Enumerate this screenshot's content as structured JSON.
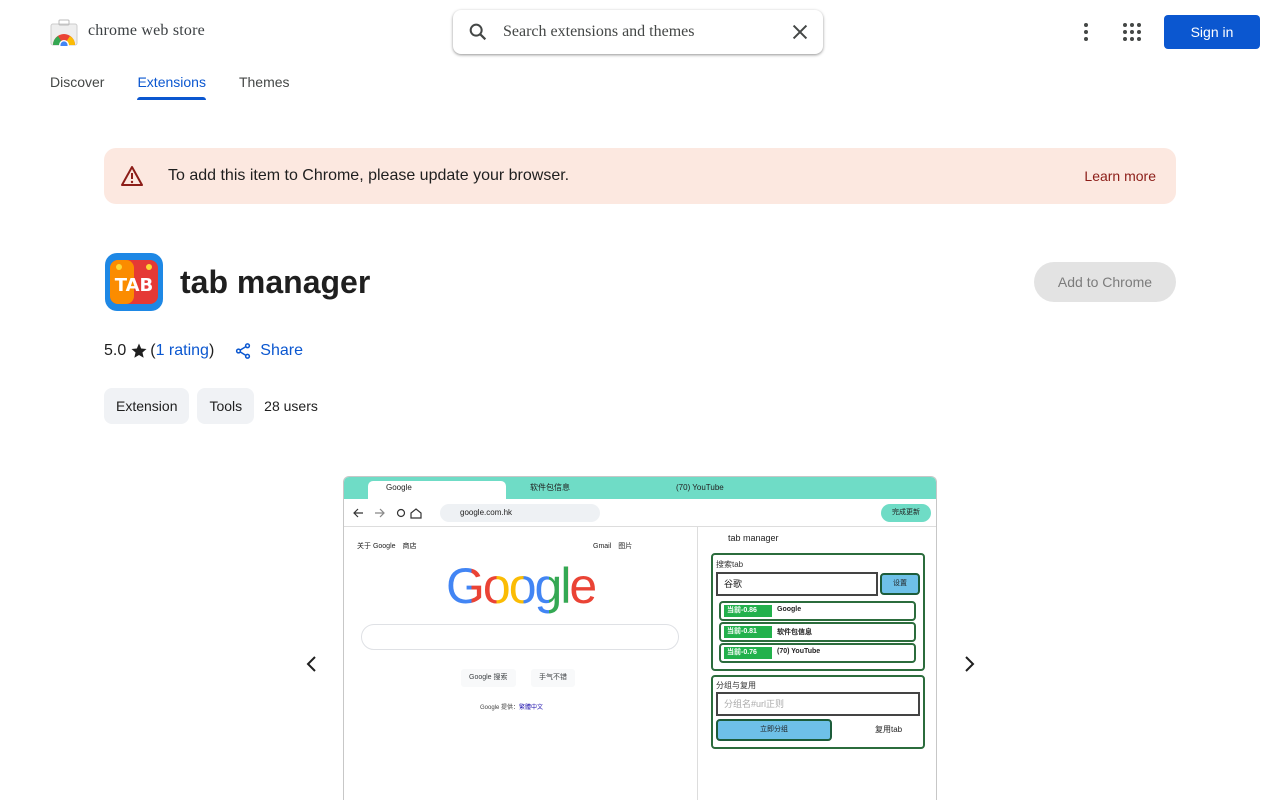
{
  "header": {
    "store_name": "chrome web store",
    "search_placeholder": "Search extensions and themes",
    "sign_in": "Sign in"
  },
  "nav": {
    "tabs": [
      {
        "label": "Discover",
        "active": false
      },
      {
        "label": "Extensions",
        "active": true
      },
      {
        "label": "Themes",
        "active": false
      }
    ]
  },
  "banner": {
    "message": "To add this item to Chrome, please update your browser.",
    "learn_more": "Learn more"
  },
  "extension": {
    "icon_text": "TAB",
    "title": "tab manager",
    "add_button": "Add to Chrome",
    "rating": "5.0",
    "rating_count": "1 rating",
    "share": "Share",
    "chips": [
      "Extension",
      "Tools"
    ],
    "users": "28 users"
  },
  "screenshot": {
    "tabs": [
      "Google",
      "软件包信息",
      "(70) YouTube"
    ],
    "url": "google.com.hk",
    "done": "完成更新",
    "google_links_left": "关于 Google　商店",
    "google_links_right": "Gmail　图片",
    "google_logo": "Google",
    "google_buttons": [
      "Google 搜索",
      "手气不错"
    ],
    "google_provided": "Google 提供：",
    "google_lang": "繁體中文",
    "panel_title": "tab manager",
    "search_tab_label": "搜索tab",
    "search_value": "谷歌",
    "settings": "设置",
    "results": [
      {
        "score": "当前-0.86",
        "name": "Google"
      },
      {
        "score": "当前-0.81",
        "name": "软件包信息"
      },
      {
        "score": "当前-0.76",
        "name": "(70) YouTube"
      }
    ],
    "group_label": "分组与复用",
    "group_placeholder": "分组名#url正则",
    "group_now": "立即分组",
    "reuse_tab": "复用tab"
  },
  "colors": {
    "accent": "#0b57d0",
    "banner_bg": "#fce8e0",
    "banner_link": "#8c1d18",
    "screenshot_tabbar": "#6fdcc6"
  }
}
